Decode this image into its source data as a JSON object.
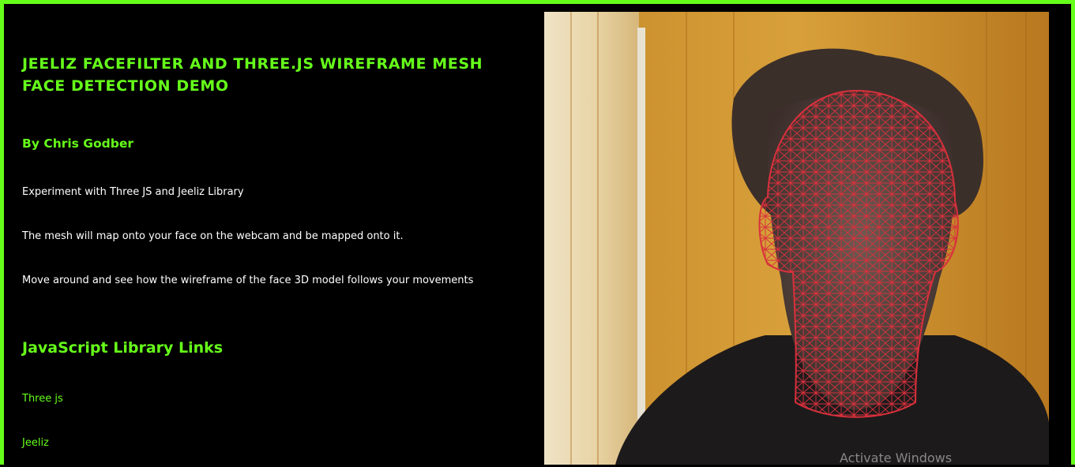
{
  "page": {
    "title": "JEELIZ FACEFILTER AND THREE.JS WIREFRAME MESH FACE DETECTION DEMO",
    "author": "By Chris Godber",
    "paragraphs": [
      "Experiment with Three JS and Jeeliz Library",
      "The mesh will map onto your face on the webcam and be mapped onto it.",
      "Move around and see how the wireframe of the face 3D model follows your movements"
    ],
    "links_heading": "JavaScript Library Links",
    "links": [
      {
        "label": "Three js"
      },
      {
        "label": "Jeeliz"
      }
    ]
  },
  "webcam": {
    "overlay": "wireframe-face-mesh",
    "mesh_color": "#d9303c"
  },
  "os_watermark": "Activate Windows",
  "colors": {
    "accent": "#66ff1a",
    "background": "#000000",
    "text": "#ffffff"
  }
}
